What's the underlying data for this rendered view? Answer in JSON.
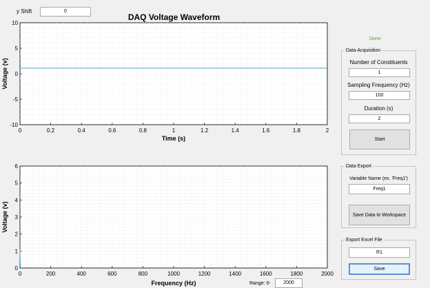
{
  "header": {
    "yshift_label": "y Shift",
    "yshift_value": "0",
    "title": "DAQ Voltage Waveform"
  },
  "status": {
    "text": "Done",
    "color": "#5aa02c"
  },
  "acquisition": {
    "title": "Data Acquisition",
    "constituents_label": "Number of Constituents",
    "constituents_value": "1",
    "freq_label": "Sampling Frequency (Hz)",
    "freq_value": "100",
    "duration_label": "Duration (s)",
    "duration_value": "2",
    "start_label": "Start"
  },
  "export": {
    "title": "Data Export",
    "var_label": "Variable Name (ex. 'Freq1')",
    "var_value": "Freq1",
    "save_ws_label": "Save Data to Workspace"
  },
  "excel": {
    "title": "Export Excel File",
    "file_value": "R1",
    "save_label": "Save"
  },
  "range": {
    "label": "Range:  0-",
    "value": "2000"
  },
  "chart_data": [
    {
      "type": "line",
      "xlabel": "Time (s)",
      "ylabel": "Voltage (v)",
      "xlim": [
        0,
        2
      ],
      "ylim": [
        -10,
        10
      ],
      "xticks": [
        "0",
        "0.2",
        "0.4",
        "0.6",
        "0.8",
        "1",
        "1.2",
        "1.4",
        "1.6",
        "1.8",
        "2"
      ],
      "yticks": [
        "-10",
        "-5",
        "0",
        "5",
        "10"
      ],
      "grid": "minor",
      "series": [
        {
          "x": [
            0,
            2
          ],
          "values": [
            1.1,
            1.1
          ],
          "color": "#4aa8c8"
        }
      ]
    },
    {
      "type": "line",
      "xlabel": "Frequency (Hz)",
      "ylabel": "Voltage (v)",
      "xlim": [
        0,
        2000
      ],
      "ylim": [
        0,
        6
      ],
      "xticks": [
        "0",
        "200",
        "400",
        "600",
        "800",
        "1000",
        "1200",
        "1400",
        "1600",
        "1800",
        "2000"
      ],
      "yticks": [
        "0",
        "1",
        "2",
        "3",
        "4",
        "5",
        "6"
      ],
      "grid": "minor",
      "series": [
        {
          "x": [
            0,
            2,
            4,
            6
          ],
          "values": [
            1.1,
            0.05,
            0.02,
            0.01
          ],
          "color": "#4aa8c8"
        }
      ]
    }
  ]
}
